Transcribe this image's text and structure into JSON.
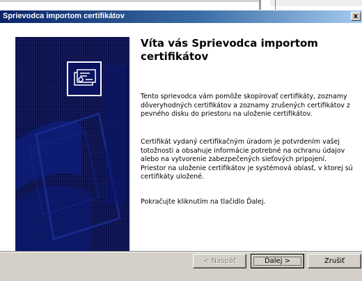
{
  "window": {
    "title": "Sprievodca importom certifikátov",
    "close_glyph": "x"
  },
  "wizard": {
    "heading": "Víta vás Sprievodca importom certifikátov",
    "paragraph_1": "Tento sprievodca vám pomôže skopírovať certifikáty, zoznamy dôveryhodných certifikátov a zoznamy zrušených certifikátov z pevného disku do priestoru na uloženie certifikátov.",
    "paragraph_2": "Certifikát vydaný certifikačným úradom je potvrdením vašej totožnosti a obsahuje informácie potrebné na ochranu údajov alebo na vytvorenie zabezpečených sieťových pripojení. Priestor na uloženie certifikátov je systémová oblasť, v ktorej sú certifikáty uložené.",
    "paragraph_3": "Pokračujte kliknutím na tlačidlo Ďalej.",
    "side_icon": "certificate-icon"
  },
  "buttons": {
    "back_label": "< Naspäť",
    "back_enabled": false,
    "next_label": "Ďalej >",
    "cancel_label": "Zrušiť"
  },
  "colors": {
    "titlebar_start": "#0a246a",
    "titlebar_end": "#a6caf0",
    "side_panel": "#050c4a",
    "dialog_face": "#d4d0c8"
  }
}
